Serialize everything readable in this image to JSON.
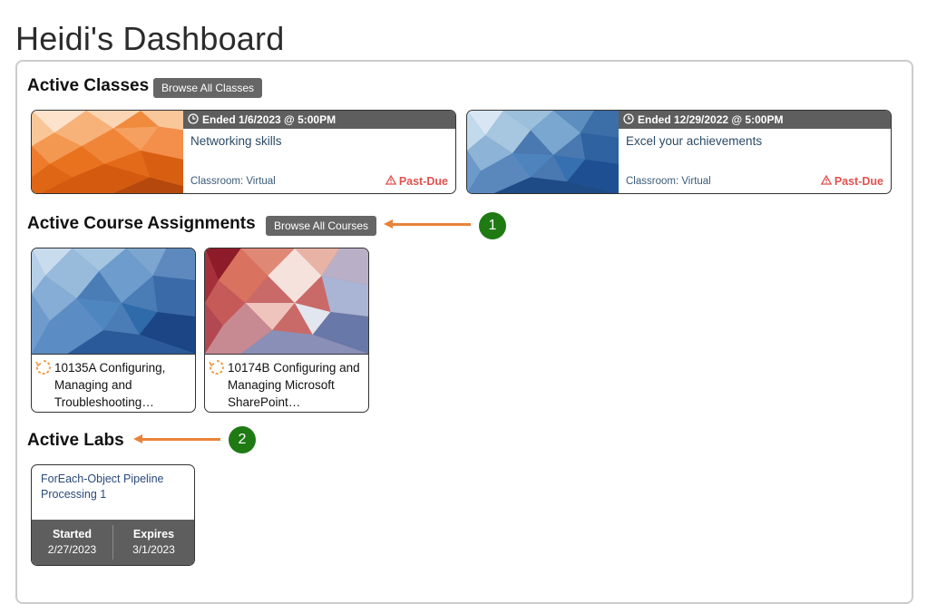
{
  "page": {
    "title": "Heidi's Dashboard"
  },
  "active_classes": {
    "heading": "Active Classes",
    "browse_label": "Browse All Classes",
    "items": [
      {
        "status": "Ended 1/6/2023 @ 5:00PM",
        "name": "Networking skills",
        "classroom": "Classroom: Virtual",
        "flag": "Past-Due",
        "palette": "orange"
      },
      {
        "status": "Ended 12/29/2022 @ 5:00PM",
        "name": "Excel your achievements",
        "classroom": "Classroom: Virtual",
        "flag": "Past-Due",
        "palette": "blue"
      }
    ]
  },
  "course_assignments": {
    "heading": "Active Course Assignments",
    "browse_label": "Browse All Courses",
    "items": [
      {
        "title": "10135A Configuring, Managing and Troubleshooting…",
        "palette": "blue"
      },
      {
        "title": "10174B Configuring and Managing Microsoft SharePoint…",
        "palette": "red"
      }
    ]
  },
  "labs": {
    "heading": "Active Labs",
    "items": [
      {
        "name": "ForEach-Object Pipeline Processing 1",
        "started_label": "Started",
        "started": "2/27/2023",
        "expires_label": "Expires",
        "expires": "3/1/2023"
      }
    ]
  },
  "annotations": [
    {
      "number": "1"
    },
    {
      "number": "2"
    }
  ],
  "colors": {
    "accent_dark": "#5e5e5e",
    "past_due": "#e0524f",
    "annotation_arrow": "#e8833a",
    "annotation_badge": "#1f7a14",
    "progress_icon": "#f0a050"
  }
}
